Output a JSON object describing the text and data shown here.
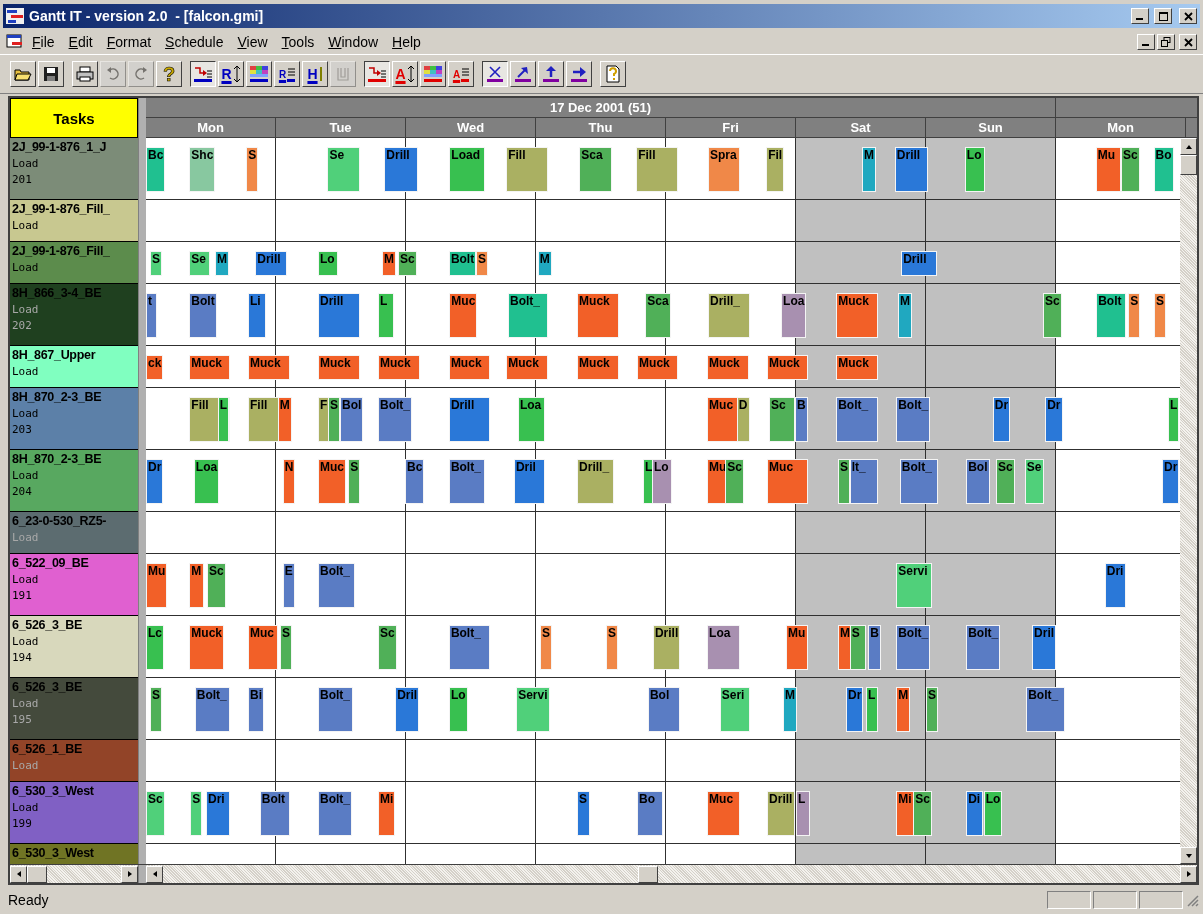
{
  "window": {
    "title": "Gantt IT - version 2.0  - [falcon.gmi]"
  },
  "menu": [
    {
      "label": "File"
    },
    {
      "label": "Edit"
    },
    {
      "label": "Format"
    },
    {
      "label": "Schedule"
    },
    {
      "label": "View"
    },
    {
      "label": "Tools"
    },
    {
      "label": "Window"
    },
    {
      "label": "Help"
    }
  ],
  "toolbar": [
    {
      "buttons": [
        {
          "kind": "open",
          "pressed": false,
          "disabled": false
        },
        {
          "kind": "save",
          "pressed": false,
          "disabled": false
        }
      ]
    },
    {
      "buttons": [
        {
          "kind": "print",
          "pressed": false,
          "disabled": false
        },
        {
          "kind": "undo",
          "pressed": false,
          "disabled": true
        },
        {
          "kind": "redo",
          "pressed": false,
          "disabled": true
        },
        {
          "kind": "text",
          "label": "?",
          "pressed": false,
          "disabled": false
        }
      ]
    },
    {
      "buttons": [
        {
          "kind": "arrow-list",
          "color": "#0000c0",
          "pressed": true,
          "disabled": false
        },
        {
          "kind": "letter-sort",
          "label": "R",
          "color": "#0000c0",
          "pressed": false,
          "disabled": false
        },
        {
          "kind": "palette",
          "color": "#0000c0",
          "pressed": false,
          "disabled": false
        },
        {
          "kind": "letter-list",
          "label": "R",
          "color": "#0000c0",
          "pressed": false,
          "disabled": false
        },
        {
          "kind": "letter-bar",
          "label": "H",
          "color": "#0000c0",
          "pressed": false,
          "disabled": false
        },
        {
          "kind": "cup",
          "pressed": false,
          "disabled": true
        }
      ]
    },
    {
      "buttons": [
        {
          "kind": "arrow-list",
          "color": "#e00000",
          "pressed": true,
          "disabled": false
        },
        {
          "kind": "letter-sort",
          "label": "A",
          "color": "#e00000",
          "pressed": false,
          "disabled": false
        },
        {
          "kind": "palette",
          "color": "#e00000",
          "pressed": false,
          "disabled": false
        },
        {
          "kind": "letter-list",
          "label": "A",
          "color": "#e00000",
          "pressed": false,
          "disabled": false
        }
      ]
    },
    {
      "buttons": [
        {
          "kind": "cross",
          "color": "#8000a0",
          "pressed": true,
          "disabled": false
        },
        {
          "kind": "diag-arrow",
          "color": "#8000a0",
          "pressed": false,
          "disabled": false
        },
        {
          "kind": "up-arrow",
          "color": "#8000a0",
          "pressed": false,
          "disabled": false
        },
        {
          "kind": "right-arrow",
          "color": "#8000a0",
          "pressed": false,
          "disabled": false
        }
      ]
    },
    {
      "buttons": [
        {
          "kind": "help-page",
          "pressed": false,
          "disabled": false
        }
      ]
    }
  ],
  "tasks_header": "Tasks",
  "chart": {
    "week_label": "17 Dec 2001 (51)",
    "days": [
      {
        "label": "Mon",
        "weekend": false
      },
      {
        "label": "Tue",
        "weekend": false
      },
      {
        "label": "Wed",
        "weekend": false
      },
      {
        "label": "Thu",
        "weekend": false
      },
      {
        "label": "Fri",
        "weekend": false
      },
      {
        "label": "Sat",
        "weekend": true
      },
      {
        "label": "Sun",
        "weekend": true
      },
      {
        "label": "Mon",
        "weekend": false
      }
    ]
  },
  "rows": [
    {
      "name": "2J_99-1-876_1_J",
      "type": "Load",
      "number": "201",
      "color": "#7c8c78",
      "bars": [
        {
          "label": "Bc",
          "color": "#20c090"
        },
        {
          "label": "Shc",
          "color": "#88c8a0"
        },
        {
          "label": "S",
          "color": "#f08848"
        },
        {
          "label": "Se",
          "color": "#50d07a"
        },
        {
          "label": "Drill",
          "color": "#2a78d8"
        },
        {
          "label": "Load",
          "color": "#38c050"
        },
        {
          "label": "Fill",
          "color": "#aab062"
        },
        {
          "label": "Sca",
          "color": "#50b058"
        },
        {
          "label": "Fill",
          "color": "#aab062"
        },
        {
          "label": "Spra",
          "color": "#f08848"
        },
        {
          "label": "Fil",
          "color": "#aab062"
        },
        {
          "label": "M",
          "color": "#20a8c0"
        },
        {
          "label": "Drill",
          "color": "#2a78d8"
        },
        {
          "label": "Lo",
          "color": "#38c050"
        },
        {
          "label": "Mu",
          "color": "#f26028"
        },
        {
          "label": "Sc",
          "color": "#50b058"
        },
        {
          "label": "Bo",
          "color": "#20c090"
        }
      ]
    },
    {
      "name": "2J_99-1-876_Fill_",
      "type": "Load",
      "color": "#c8c890",
      "bars": []
    },
    {
      "name": "2J_99-1-876_Fill_",
      "type": "Load",
      "color": "#5c8c4c",
      "bars": [
        {
          "label": "S",
          "color": "#50d07a"
        },
        {
          "label": "Se",
          "color": "#50d07a"
        },
        {
          "label": "M",
          "color": "#20a8c0"
        },
        {
          "label": "Drill",
          "color": "#2a78d8"
        },
        {
          "label": "Lo",
          "color": "#38c050"
        },
        {
          "label": "M",
          "color": "#f26028"
        },
        {
          "label": "Sc",
          "color": "#50b058"
        },
        {
          "label": "Bolt",
          "color": "#20c090"
        },
        {
          "label": "S",
          "color": "#f08848"
        },
        {
          "label": "M",
          "color": "#20a8c0"
        },
        {
          "label": "Drill",
          "color": "#2a78d8"
        }
      ]
    },
    {
      "name": "8H_866_3-4_BE",
      "type": "Load",
      "number": "202",
      "color": "#1f401f",
      "bars": [
        {
          "label": "t",
          "color": "#5a7cc4"
        },
        {
          "label": "Bolt",
          "color": "#5a7cc4"
        },
        {
          "label": "Li",
          "color": "#2a78d8"
        },
        {
          "label": "Drill",
          "color": "#2a78d8"
        },
        {
          "label": "L",
          "color": "#38c050"
        },
        {
          "label": "Muc",
          "color": "#f26028"
        },
        {
          "label": "Bolt_",
          "color": "#20c090"
        },
        {
          "label": "Muck",
          "color": "#f26028"
        },
        {
          "label": "Sca",
          "color": "#50b058"
        },
        {
          "label": "Drill_",
          "color": "#aab062"
        },
        {
          "label": "Loa",
          "color": "#a890b0"
        },
        {
          "label": "Muck",
          "color": "#f26028"
        },
        {
          "label": "M",
          "color": "#20a8c0"
        },
        {
          "label": "Sc",
          "color": "#50b058"
        },
        {
          "label": "Bolt",
          "color": "#20c090"
        },
        {
          "label": "S",
          "color": "#f08848"
        },
        {
          "label": "S",
          "color": "#f08848"
        }
      ]
    },
    {
      "name": "8H_867_Upper",
      "type": "Load",
      "color": "#80ffc0",
      "bars": [
        {
          "label": "ck",
          "color": "#f26028"
        },
        {
          "label": "Muck",
          "color": "#f26028"
        },
        {
          "label": "Muck",
          "color": "#f26028"
        },
        {
          "label": "Muck",
          "color": "#f26028"
        },
        {
          "label": "Muck",
          "color": "#f26028"
        },
        {
          "label": "Muck",
          "color": "#f26028"
        },
        {
          "label": "Muck",
          "color": "#f26028"
        },
        {
          "label": "Muck",
          "color": "#f26028"
        },
        {
          "label": "Muck",
          "color": "#f26028"
        },
        {
          "label": "Muck",
          "color": "#f26028"
        },
        {
          "label": "Muck",
          "color": "#f26028"
        },
        {
          "label": "Muck",
          "color": "#f26028"
        }
      ]
    },
    {
      "name": "8H_870_2-3_BE",
      "type": "Load",
      "number": "203",
      "color": "#5c80a8",
      "bars": [
        {
          "label": "Fill",
          "color": "#aab062"
        },
        {
          "label": "L",
          "color": "#38c050"
        },
        {
          "label": "Fill",
          "color": "#aab062"
        },
        {
          "label": "M",
          "color": "#f26028"
        },
        {
          "label": "F",
          "color": "#aab062"
        },
        {
          "label": "S",
          "color": "#50b058"
        },
        {
          "label": "Bol",
          "color": "#5a7cc4"
        },
        {
          "label": "Bolt_",
          "color": "#5a7cc4"
        },
        {
          "label": "Drill",
          "color": "#2a78d8"
        },
        {
          "label": "Loa",
          "color": "#38c050"
        },
        {
          "label": "Muc",
          "color": "#f26028"
        },
        {
          "label": "D",
          "color": "#aab062"
        },
        {
          "label": "Sc",
          "color": "#50b058"
        },
        {
          "label": "B",
          "color": "#5a7cc4"
        },
        {
          "label": "Bolt_",
          "color": "#5a7cc4"
        },
        {
          "label": "Bolt_",
          "color": "#5a7cc4"
        },
        {
          "label": "Dr",
          "color": "#2a78d8"
        },
        {
          "label": "Dr",
          "color": "#2a78d8"
        },
        {
          "label": "L",
          "color": "#38c050"
        }
      ]
    },
    {
      "name": "8H_870_2-3_BE",
      "type": "Load",
      "number": "204",
      "color": "#58a860",
      "bars": [
        {
          "label": "Dr",
          "color": "#2a78d8"
        },
        {
          "label": "Loa",
          "color": "#38c050"
        },
        {
          "label": "N",
          "color": "#f26028"
        },
        {
          "label": "Muc",
          "color": "#f26028"
        },
        {
          "label": "S",
          "color": "#50b058"
        },
        {
          "label": "Bc",
          "color": "#5a7cc4"
        },
        {
          "label": "Bolt_",
          "color": "#5a7cc4"
        },
        {
          "label": "Dril",
          "color": "#2a78d8"
        },
        {
          "label": "Drill_",
          "color": "#aab062"
        },
        {
          "label": "L",
          "color": "#38c050"
        },
        {
          "label": "Lo",
          "color": "#a890b0"
        },
        {
          "label": "Mu",
          "color": "#f26028"
        },
        {
          "label": "Sc",
          "color": "#50b058"
        },
        {
          "label": "Muc",
          "color": "#f26028"
        },
        {
          "label": "S",
          "color": "#50b058"
        },
        {
          "label": "lt_",
          "color": "#5a7cc4"
        },
        {
          "label": "Bolt_",
          "color": "#5a7cc4"
        },
        {
          "label": "Bol",
          "color": "#5a7cc4"
        },
        {
          "label": "Sc",
          "color": "#50b058"
        },
        {
          "label": "Se",
          "color": "#50d07a"
        },
        {
          "label": "Dr",
          "color": "#2a78d8"
        }
      ]
    },
    {
      "name": "6_23-0-530_RZ5-",
      "type": "Load",
      "color": "#5c6c70",
      "bars": []
    },
    {
      "name": "6_522_09_BE",
      "type": "Load",
      "number": "191",
      "color": "#e060d0",
      "bars": [
        {
          "label": "Mu",
          "color": "#f26028"
        },
        {
          "label": "M",
          "color": "#f26028"
        },
        {
          "label": "Sc",
          "color": "#50b058"
        },
        {
          "label": "E",
          "color": "#5a7cc4"
        },
        {
          "label": "Bolt_",
          "color": "#5a7cc4"
        },
        {
          "label": "Servi",
          "color": "#50d07a"
        },
        {
          "label": "Dri",
          "color": "#2a78d8"
        }
      ]
    },
    {
      "name": "6_526_3_BE",
      "type": "Load",
      "number": "194",
      "color": "#d8d8bc",
      "bars": [
        {
          "label": "Lc",
          "color": "#38c050"
        },
        {
          "label": "Muck",
          "color": "#f26028"
        },
        {
          "label": "Muc",
          "color": "#f26028"
        },
        {
          "label": "S",
          "color": "#50b058"
        },
        {
          "label": "Sc",
          "color": "#50b058"
        },
        {
          "label": "Bolt_",
          "color": "#5a7cc4"
        },
        {
          "label": "S",
          "color": "#f08848"
        },
        {
          "label": "S",
          "color": "#f08848"
        },
        {
          "label": "Drill",
          "color": "#aab062"
        },
        {
          "label": "Loa",
          "color": "#a890b0"
        },
        {
          "label": "Mu",
          "color": "#f26028"
        },
        {
          "label": "M",
          "color": "#f26028"
        },
        {
          "label": "S",
          "color": "#50b058"
        },
        {
          "label": "B",
          "color": "#5a7cc4"
        },
        {
          "label": "Bolt_",
          "color": "#5a7cc4"
        },
        {
          "label": "Bolt_",
          "color": "#5a7cc4"
        },
        {
          "label": "Dril",
          "color": "#2a78d8"
        }
      ]
    },
    {
      "name": "6_526_3_BE",
      "type": "Load",
      "number": "195",
      "color": "#444a3c",
      "bars": [
        {
          "label": "S",
          "color": "#50b058"
        },
        {
          "label": "Bolt_",
          "color": "#5a7cc4"
        },
        {
          "label": "Bi",
          "color": "#5a7cc4"
        },
        {
          "label": "Bolt_",
          "color": "#5a7cc4"
        },
        {
          "label": "Dril",
          "color": "#2a78d8"
        },
        {
          "label": "Lo",
          "color": "#38c050"
        },
        {
          "label": "Servi",
          "color": "#50d07a"
        },
        {
          "label": "Bol",
          "color": "#5a7cc4"
        },
        {
          "label": "Seri",
          "color": "#50d07a"
        },
        {
          "label": "M",
          "color": "#20a8c0"
        },
        {
          "label": "Dr",
          "color": "#2a78d8"
        },
        {
          "label": "L",
          "color": "#38c050"
        },
        {
          "label": "M",
          "color": "#f26028"
        },
        {
          "label": "S",
          "color": "#50b058"
        },
        {
          "label": "Bolt_",
          "color": "#5a7cc4"
        }
      ]
    },
    {
      "name": "6_526_1_BE",
      "type": "Load",
      "color": "#924428",
      "bars": []
    },
    {
      "name": "6_530_3_West",
      "type": "Load",
      "number": "199",
      "color": "#8060c4",
      "bars": [
        {
          "label": "Sc",
          "color": "#50d07a"
        },
        {
          "label": "S",
          "color": "#50d07a"
        },
        {
          "label": "Dri",
          "color": "#2a78d8"
        },
        {
          "label": "Bolt",
          "color": "#5a7cc4"
        },
        {
          "label": "Bolt_",
          "color": "#5a7cc4"
        },
        {
          "label": "Mi",
          "color": "#f26028"
        },
        {
          "label": "S",
          "color": "#2a78d8"
        },
        {
          "label": "Bo",
          "color": "#5a7cc4"
        },
        {
          "label": "Muc",
          "color": "#f26028"
        },
        {
          "label": "Drill",
          "color": "#aab062"
        },
        {
          "label": "L",
          "color": "#a890b0"
        },
        {
          "label": "Mi",
          "color": "#f26028"
        },
        {
          "label": "Sc",
          "color": "#50b058"
        },
        {
          "label": "Di",
          "color": "#2a78d8"
        },
        {
          "label": "Lo",
          "color": "#38c050"
        }
      ]
    },
    {
      "name": "6_530_3_West",
      "color": "#707424",
      "bars": []
    }
  ],
  "status_bar": {
    "text": "Ready"
  }
}
